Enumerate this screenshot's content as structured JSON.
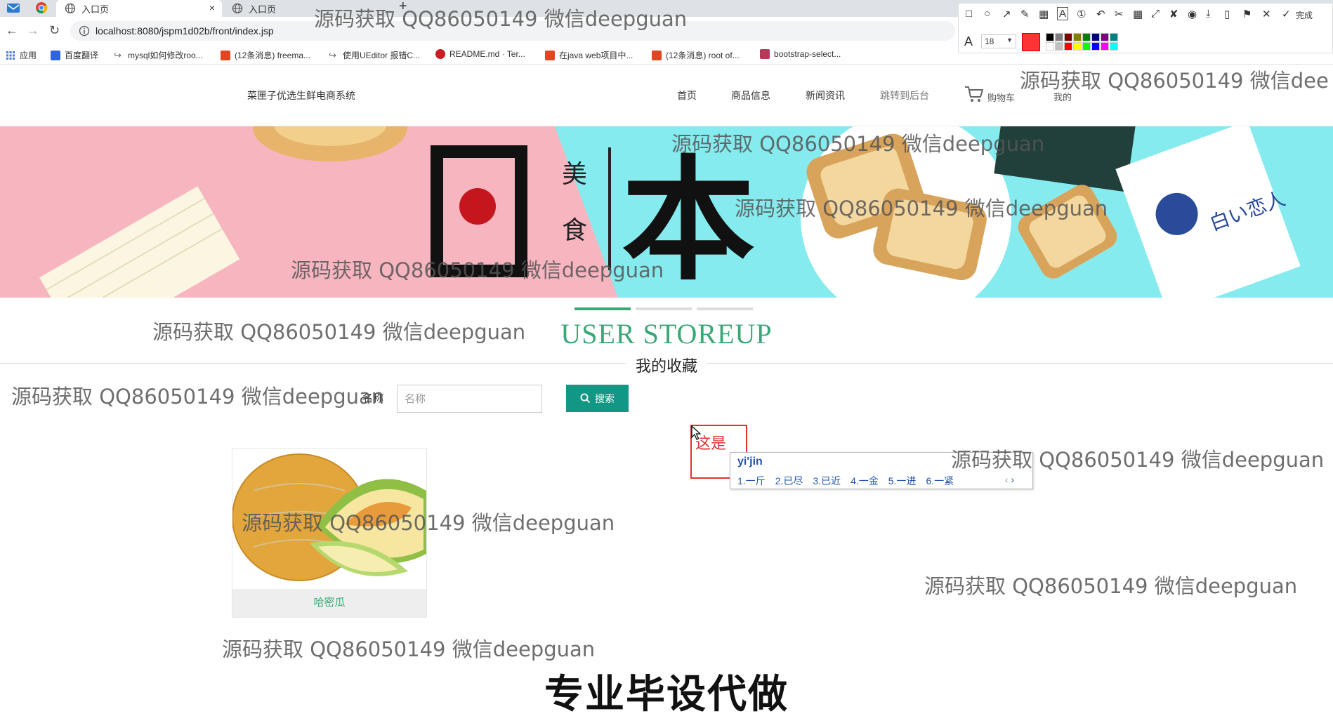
{
  "browser": {
    "tabs": [
      {
        "label": "入口页",
        "close": "×"
      },
      {
        "label": "入口页"
      }
    ],
    "new_tab": "+",
    "url": "localhost:8080/jspm1d02b/front/index.jsp",
    "bookmarks": [
      {
        "label": "应用",
        "color": "#4a7bd6"
      },
      {
        "label": "百度翻译",
        "color": "#2d65e0"
      },
      {
        "label": "mysql如何修改roo...",
        "color": "#666666"
      },
      {
        "label": "(12条消息) freema...",
        "color": "#e0461f"
      },
      {
        "label": "使用UEditor 报错C...",
        "color": "#666666"
      },
      {
        "label": "README.md · Ter...",
        "color": "#c71d23"
      },
      {
        "label": "在java web项目中...",
        "color": "#e0461f"
      },
      {
        "label": "(12条消息) root of...",
        "color": "#e0461f"
      },
      {
        "label": "bootstrap-select...",
        "color": "#b23b5a"
      }
    ]
  },
  "screenshot_tool": {
    "done_label": "完成",
    "font_size": "18",
    "palette": [
      "#000000",
      "#808080",
      "#800000",
      "#808000",
      "#008000",
      "#000080",
      "#800080",
      "#008080",
      "#ffffff",
      "#c0c0c0",
      "#ff0000",
      "#ffff00",
      "#00ff00",
      "#0000ff",
      "#ff00ff",
      "#00ffff"
    ]
  },
  "site": {
    "brand": "菜匣子优选生鲜电商系统",
    "nav": [
      "首页",
      "商品信息",
      "新闻资讯",
      "跳转到后台"
    ],
    "cart_label": "购物车",
    "mine_label": "我的",
    "section_title": "USER STOREUP",
    "section_subtitle": "我的收藏",
    "search": {
      "label": "名称",
      "placeholder": "名称",
      "button_label": "搜索"
    },
    "products": [
      {
        "name": "哈密瓜"
      }
    ]
  },
  "annotation": {
    "text": "这是",
    "ime_input": "yi'jin",
    "ime_candidates": [
      "1.一斤",
      "2.已尽",
      "3.已近",
      "4.一金",
      "5.一进",
      "6.一紧"
    ]
  },
  "overlay_banner": "专业毕设代做",
  "watermark": "源码获取 QQ86050149 微信deepguan",
  "watermark_cut": "源码获取 QQ86050149 微信dee"
}
